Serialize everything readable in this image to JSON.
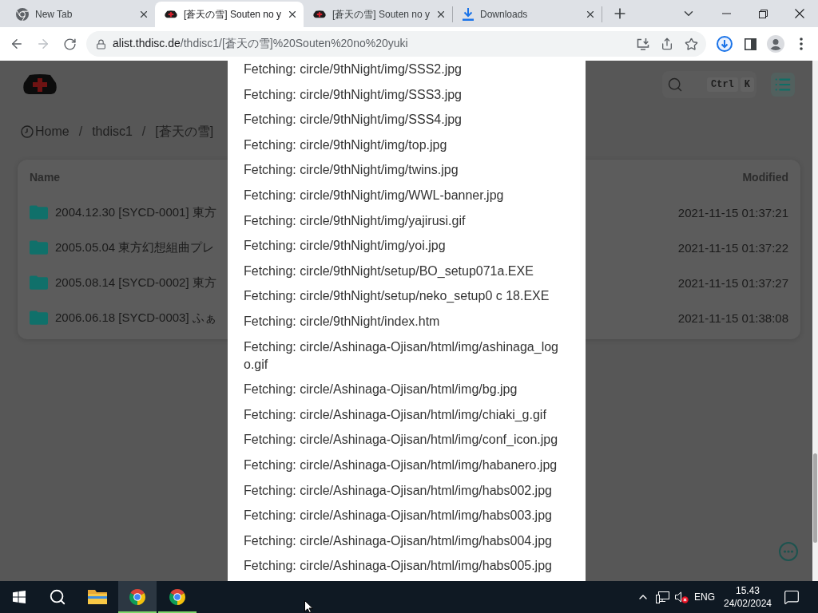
{
  "browser": {
    "tabs": [
      {
        "kind": "newtab",
        "title": "New Tab",
        "selected": false
      },
      {
        "kind": "site",
        "title": "[蒼天の雪] Souten no y",
        "selected": true
      },
      {
        "kind": "site",
        "title": "[蒼天の雪] Souten no y",
        "selected": false
      },
      {
        "kind": "downloads",
        "title": "Downloads",
        "selected": false
      }
    ],
    "back": {
      "disabled": false
    },
    "forward": {
      "disabled": true
    },
    "address": {
      "host": "alist.thdisc.de",
      "path": "/thdisc1/[蒼天の雪]%20Souten%20no%20yuki"
    }
  },
  "page": {
    "search": {
      "keys": [
        "Ctrl",
        "K"
      ]
    },
    "breadcrumb": {
      "items": [
        "Home",
        "thdisc1",
        "[蒼天の雪]"
      ],
      "separators": [
        "/",
        "/"
      ]
    },
    "table": {
      "columns": [
        "Name",
        "Modified"
      ],
      "rows": [
        {
          "name": "2004.12.30 [SYCD-0001] 東方",
          "modified": "2021-11-15 01:37:21"
        },
        {
          "name": "2005.05.04 東方幻想組曲プレ",
          "modified": "2021-11-15 01:37:22"
        },
        {
          "name": "2005.08.14 [SYCD-0002] 東方",
          "modified": "2021-11-15 01:37:27"
        },
        {
          "name": "2006.06.18 [SYCD-0003] ふぁ",
          "modified": "2021-11-15 01:38:08"
        }
      ]
    }
  },
  "dialog": {
    "lines": [
      "Fetching: circle/9thNight/img/SSS2.jpg",
      "Fetching: circle/9thNight/img/SSS3.jpg",
      "Fetching: circle/9thNight/img/SSS4.jpg",
      "Fetching: circle/9thNight/img/top.jpg",
      "Fetching: circle/9thNight/img/twins.jpg",
      "Fetching: circle/9thNight/img/WWL-banner.jpg",
      "Fetching: circle/9thNight/img/yajirusi.gif",
      "Fetching: circle/9thNight/img/yoi.jpg",
      "Fetching: circle/9thNight/setup/BO_setup071a.EXE",
      "Fetching: circle/9thNight/setup/neko_setup0 c 18.EXE",
      "Fetching: circle/9thNight/index.htm",
      "Fetching: circle/Ashinaga-Ojisan/html/img/ashinaga_logo.gif",
      "Fetching: circle/Ashinaga-Ojisan/html/img/bg.jpg",
      "Fetching: circle/Ashinaga-Ojisan/html/img/chiaki_g.gif",
      "Fetching: circle/Ashinaga-Ojisan/html/img/conf_icon.jpg",
      "Fetching: circle/Ashinaga-Ojisan/html/img/habanero.jpg",
      "Fetching: circle/Ashinaga-Ojisan/html/img/habs002.jpg",
      "Fetching: circle/Ashinaga-Ojisan/html/img/habs003.jpg",
      "Fetching: circle/Ashinaga-Ojisan/html/img/habs004.jpg",
      "Fetching: circle/Ashinaga-Ojisan/html/img/habs005.jpg"
    ]
  },
  "taskbar": {
    "apps": [
      {
        "kind": "explorer",
        "selected": false,
        "running": false
      },
      {
        "kind": "browser",
        "selected": true,
        "running": true
      },
      {
        "kind": "browser",
        "selected": false,
        "running": true
      }
    ],
    "tray": {
      "volume_muted": true,
      "language": "ENG",
      "time": "15.43",
      "date": "24/02/2024"
    }
  }
}
